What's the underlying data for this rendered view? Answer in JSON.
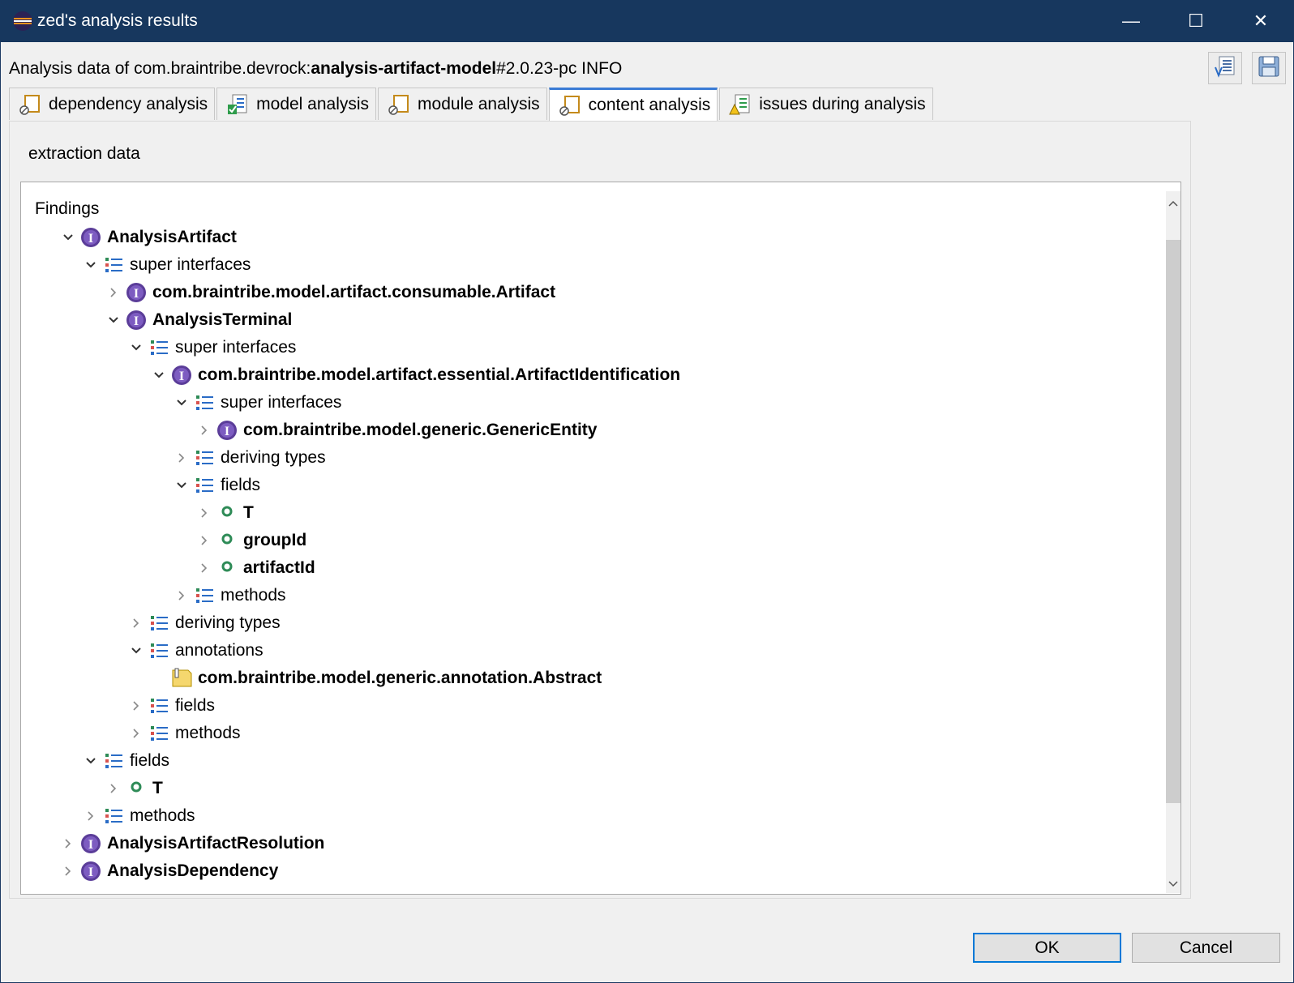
{
  "window": {
    "title": "zed's analysis results",
    "buttons": {
      "minimize": "—",
      "maximize": "☐",
      "close": "✕"
    }
  },
  "header": {
    "prefix": "Analysis data of com.braintribe.devrock:",
    "artifact": "analysis-artifact-model",
    "suffix": "#2.0.23-pc INFO"
  },
  "toolbar": {
    "icons": [
      "export-list-icon",
      "save-icon"
    ]
  },
  "tabs": [
    {
      "label": "dependency analysis",
      "icon": "dependency-icon",
      "active": false
    },
    {
      "label": "model analysis",
      "icon": "model-icon",
      "active": false
    },
    {
      "label": "module analysis",
      "icon": "module-icon",
      "active": false
    },
    {
      "label": "content analysis",
      "icon": "content-icon",
      "active": true
    },
    {
      "label": "issues during analysis",
      "icon": "issues-icon",
      "active": false
    }
  ],
  "section": {
    "label": "extraction data"
  },
  "tree": {
    "title": "Findings",
    "rows": [
      {
        "depth": 0,
        "toggle": "expanded",
        "icon": "interface",
        "label": "AnalysisArtifact",
        "bold": true
      },
      {
        "depth": 1,
        "toggle": "expanded",
        "icon": "list",
        "label": "super interfaces",
        "bold": false
      },
      {
        "depth": 2,
        "toggle": "collapsed",
        "icon": "interface",
        "label": "com.braintribe.model.artifact.consumable.Artifact",
        "bold": true
      },
      {
        "depth": 2,
        "toggle": "expanded",
        "icon": "interface",
        "label": "AnalysisTerminal",
        "bold": true
      },
      {
        "depth": 3,
        "toggle": "expanded",
        "icon": "list",
        "label": "super interfaces",
        "bold": false
      },
      {
        "depth": 4,
        "toggle": "expanded",
        "icon": "interface",
        "label": "com.braintribe.model.artifact.essential.ArtifactIdentification",
        "bold": true
      },
      {
        "depth": 5,
        "toggle": "expanded",
        "icon": "list",
        "label": "super interfaces",
        "bold": false
      },
      {
        "depth": 6,
        "toggle": "collapsed",
        "icon": "interface",
        "label": "com.braintribe.model.generic.GenericEntity",
        "bold": true
      },
      {
        "depth": 5,
        "toggle": "collapsed",
        "icon": "list",
        "label": "deriving types",
        "bold": false
      },
      {
        "depth": 5,
        "toggle": "expanded",
        "icon": "list",
        "label": "fields",
        "bold": false
      },
      {
        "depth": 6,
        "toggle": "collapsed",
        "icon": "field",
        "label": "T",
        "bold": true
      },
      {
        "depth": 6,
        "toggle": "collapsed",
        "icon": "field",
        "label": "groupId",
        "bold": true
      },
      {
        "depth": 6,
        "toggle": "collapsed",
        "icon": "field",
        "label": "artifactId",
        "bold": true
      },
      {
        "depth": 5,
        "toggle": "collapsed",
        "icon": "list",
        "label": "methods",
        "bold": false
      },
      {
        "depth": 3,
        "toggle": "collapsed",
        "icon": "list",
        "label": "deriving types",
        "bold": false
      },
      {
        "depth": 3,
        "toggle": "expanded",
        "icon": "list",
        "label": "annotations",
        "bold": false
      },
      {
        "depth": 4,
        "toggle": "none",
        "icon": "annotation",
        "label": "com.braintribe.model.generic.annotation.Abstract",
        "bold": true
      },
      {
        "depth": 3,
        "toggle": "collapsed",
        "icon": "list",
        "label": "fields",
        "bold": false
      },
      {
        "depth": 3,
        "toggle": "collapsed",
        "icon": "list",
        "label": "methods",
        "bold": false
      },
      {
        "depth": 1,
        "toggle": "expanded",
        "icon": "list",
        "label": "fields",
        "bold": false
      },
      {
        "depth": 2,
        "toggle": "collapsed",
        "icon": "field",
        "label": "T",
        "bold": true
      },
      {
        "depth": 1,
        "toggle": "collapsed",
        "icon": "list",
        "label": "methods",
        "bold": false
      },
      {
        "depth": 0,
        "toggle": "collapsed",
        "icon": "interface",
        "label": "AnalysisArtifactResolution",
        "bold": true
      },
      {
        "depth": 0,
        "toggle": "collapsed",
        "icon": "interface",
        "label": "AnalysisDependency",
        "bold": true
      }
    ]
  },
  "footer": {
    "ok_label": "OK",
    "cancel_label": "Cancel"
  },
  "colors": {
    "titlebar": "#17375e",
    "interface_icon": "#5b3d99",
    "field_icon": "#2e8b57",
    "accent": "#0078d7"
  }
}
